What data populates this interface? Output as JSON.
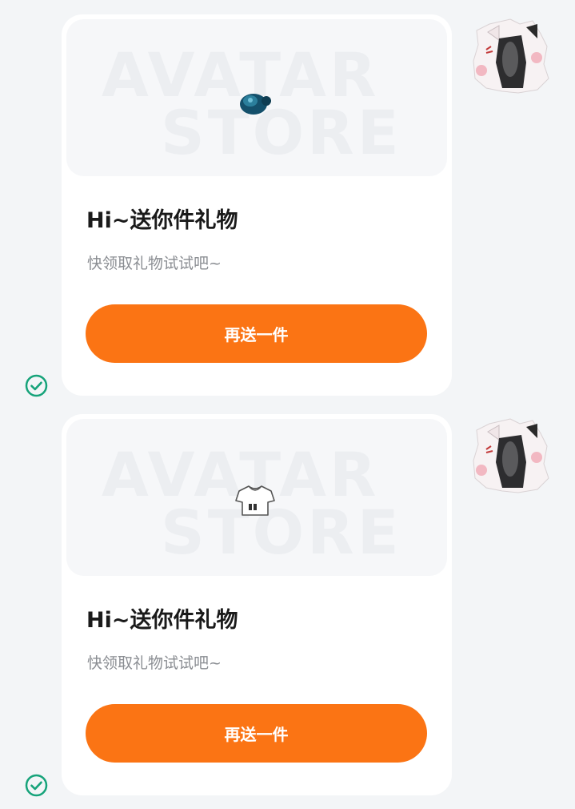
{
  "messages": [
    {
      "gift": "pacifier",
      "watermark_line1": "AVATAR",
      "watermark_line2": "STORE",
      "title": "Hi~送你件礼物",
      "subtitle": "快领取礼物试试吧~",
      "button_label": "再送一件",
      "status": "sent"
    },
    {
      "gift": "crop-top-shirt",
      "watermark_line1": "AVATAR",
      "watermark_line2": "STORE",
      "title": "Hi~送你件礼物",
      "subtitle": "快领取礼物试试吧~",
      "button_label": "再送一件",
      "status": "sent"
    }
  ],
  "colors": {
    "accent": "#fb7414",
    "check": "#16a37a",
    "background": "#f3f5f7"
  }
}
